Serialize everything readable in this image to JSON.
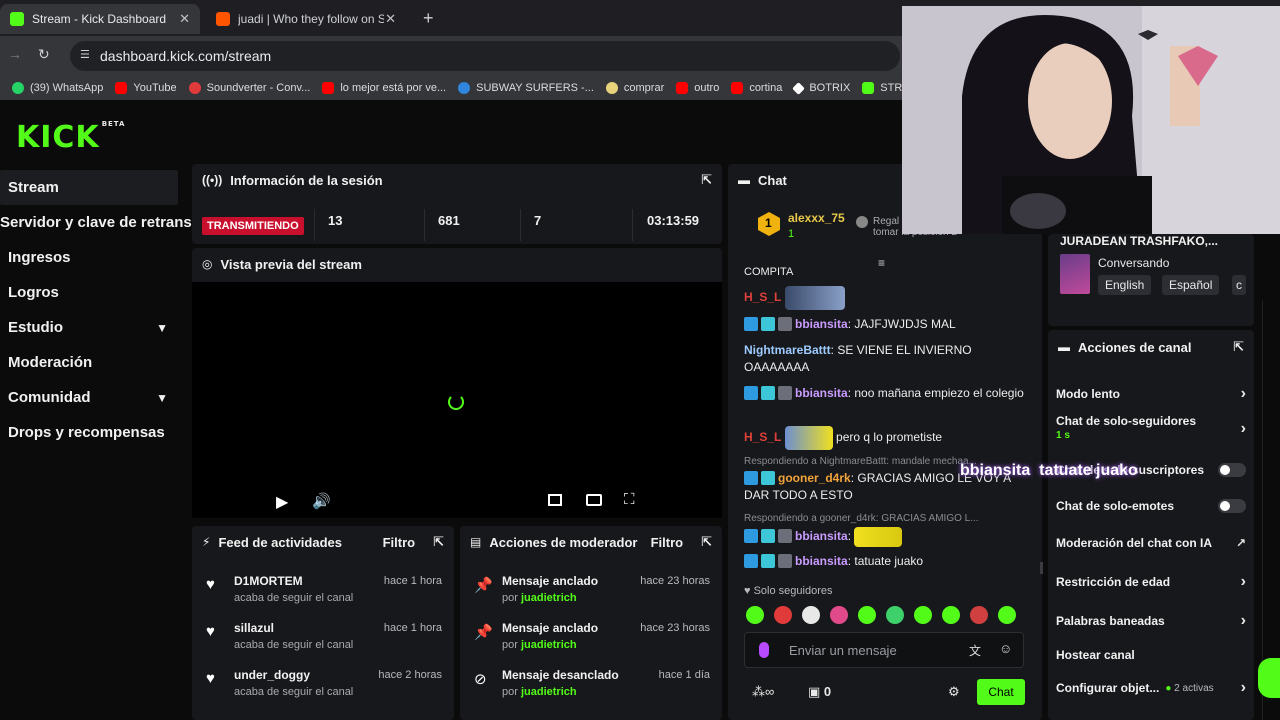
{
  "browser": {
    "tabs": [
      {
        "title": "Stream - Kick Dashboard",
        "active": true
      },
      {
        "title": "juadi | Who they follow on Sou",
        "active": false
      }
    ],
    "new_tab": "+",
    "url": "dashboard.kick.com/stream",
    "bookmarks": [
      {
        "label": "(39) WhatsApp",
        "color": "#25d366"
      },
      {
        "label": "YouTube",
        "color": "#ff0000"
      },
      {
        "label": "Soundverter - Conv...",
        "color": "#e03a3a"
      },
      {
        "label": "lo mejor está por ve...",
        "color": "#ff0000"
      },
      {
        "label": "SUBWAY SURFERS -...",
        "color": "#2e86de"
      },
      {
        "label": "comprar",
        "color": "#e8d27a"
      },
      {
        "label": "outro",
        "color": "#ff0000"
      },
      {
        "label": "cortina",
        "color": "#ff0000"
      },
      {
        "label": "BOTRIX",
        "color": "#ffffff"
      },
      {
        "label": "STR",
        "color": "#53fc18"
      }
    ]
  },
  "logo": {
    "text": "KICK",
    "tag": "BETA"
  },
  "sidebar": {
    "items": [
      {
        "label": "Stream",
        "active": true
      },
      {
        "label": "Servidor y clave de retransm",
        "active": false
      },
      {
        "label": "Ingresos",
        "active": false
      },
      {
        "label": "Logros",
        "active": false
      },
      {
        "label": "Estudio",
        "active": false,
        "expandable": true
      },
      {
        "label": "Moderación",
        "active": false
      },
      {
        "label": "Comunidad",
        "active": false,
        "expandable": true
      },
      {
        "label": "Drops y recompensas",
        "active": false
      }
    ]
  },
  "session": {
    "title": "Información de la sesión",
    "status": "TRANSMITIENDO",
    "stats": [
      "13",
      "681",
      "7",
      "03:13:59"
    ]
  },
  "preview": {
    "title": "Vista previa del stream"
  },
  "feed": {
    "title": "Feed de actividades",
    "filter": "Filtro",
    "items": [
      {
        "name": "D1MORTEM",
        "desc": "acaba de seguir el canal",
        "time": "hace 1 hora"
      },
      {
        "name": "sillazul",
        "desc": "acaba de seguir el canal",
        "time": "hace 1 hora"
      },
      {
        "name": "under_doggy",
        "desc": "acaba de seguir el canal",
        "time": "hace 2 horas"
      }
    ]
  },
  "modactions": {
    "title": "Acciones de moderador",
    "filter": "Filtro",
    "by": "por",
    "items": [
      {
        "action": "Mensaje anclado",
        "user": "juadietrich",
        "time": "hace 23 horas"
      },
      {
        "action": "Mensaje anclado",
        "user": "juadietrich",
        "time": "hace 23 horas"
      },
      {
        "action": "Mensaje desanclado",
        "user": "juadietrich",
        "time": "hace 1 día"
      }
    ]
  },
  "chat": {
    "title": "Chat",
    "top_user": {
      "name": "alexxx_75",
      "rank": "1",
      "amount": "1",
      "promo": "Regal",
      "promo2": "tomar la posición 2"
    },
    "truncated": "COMPITA",
    "messages": [
      {
        "user": "H_S_L",
        "color": "#e0403a",
        "text": ""
      },
      {
        "user": "bbiansita",
        "color": "#c99bff",
        "text": ": JAJFJWJDJS MAL"
      },
      {
        "user": "NightmareBattt",
        "color": "#9ecbff",
        "text": ": SE VIENE EL INVIERNO OAAAAAAA"
      },
      {
        "user": "bbiansita",
        "color": "#c99bff",
        "text": ": noo mañana empiezo el colegio"
      },
      {
        "user": "H_S_L",
        "color": "#e0403a",
        "text": "pero q lo prometiste"
      },
      {
        "reply": "Respondiendo a NightmareBattt: mandale mechaa..."
      },
      {
        "user": "gooner_d4rk",
        "color": "#f2a33a",
        "text": ": GRACIAS AMIGO LE VOY A DAR TODO A ESTO"
      },
      {
        "reply": "Respondiendo a gooner_d4rk: GRACIAS AMIGO L..."
      },
      {
        "user": "bbiansita",
        "color": "#c99bff",
        "text": ":"
      },
      {
        "user": "bbiansita",
        "color": "#c99bff",
        "text": ": tatuate juako"
      }
    ],
    "mode": "Solo seguidores",
    "input_placeholder": "Enviar un mensaje",
    "points": "0",
    "send": "Chat",
    "overlay_text": "bbiansita  tatuate juako"
  },
  "channel": {
    "title_trunc": "JURADEAN TRASHFAKO,...",
    "category": "Conversando",
    "tags": [
      "English",
      "Español",
      "c"
    ]
  },
  "actions": {
    "title": "Acciones de canal",
    "items": [
      {
        "label": "Modo lento",
        "type": "chevron"
      },
      {
        "label": "Chat de solo-seguidores",
        "sub": "1 s",
        "type": "chevron"
      },
      {
        "label": "Chat de solo-suscriptores",
        "type": "toggle"
      },
      {
        "label": "Chat de solo-emotes",
        "type": "toggle"
      },
      {
        "label": "Moderación del chat con IA",
        "type": "link"
      },
      {
        "label": "Restricción de edad",
        "type": "chevron"
      },
      {
        "label": "Palabras baneadas",
        "type": "chevron"
      },
      {
        "label": "Hostear canal",
        "type": "none"
      },
      {
        "label": "Configurar objet...",
        "sub": "2 activas",
        "type": "chevron"
      }
    ]
  }
}
